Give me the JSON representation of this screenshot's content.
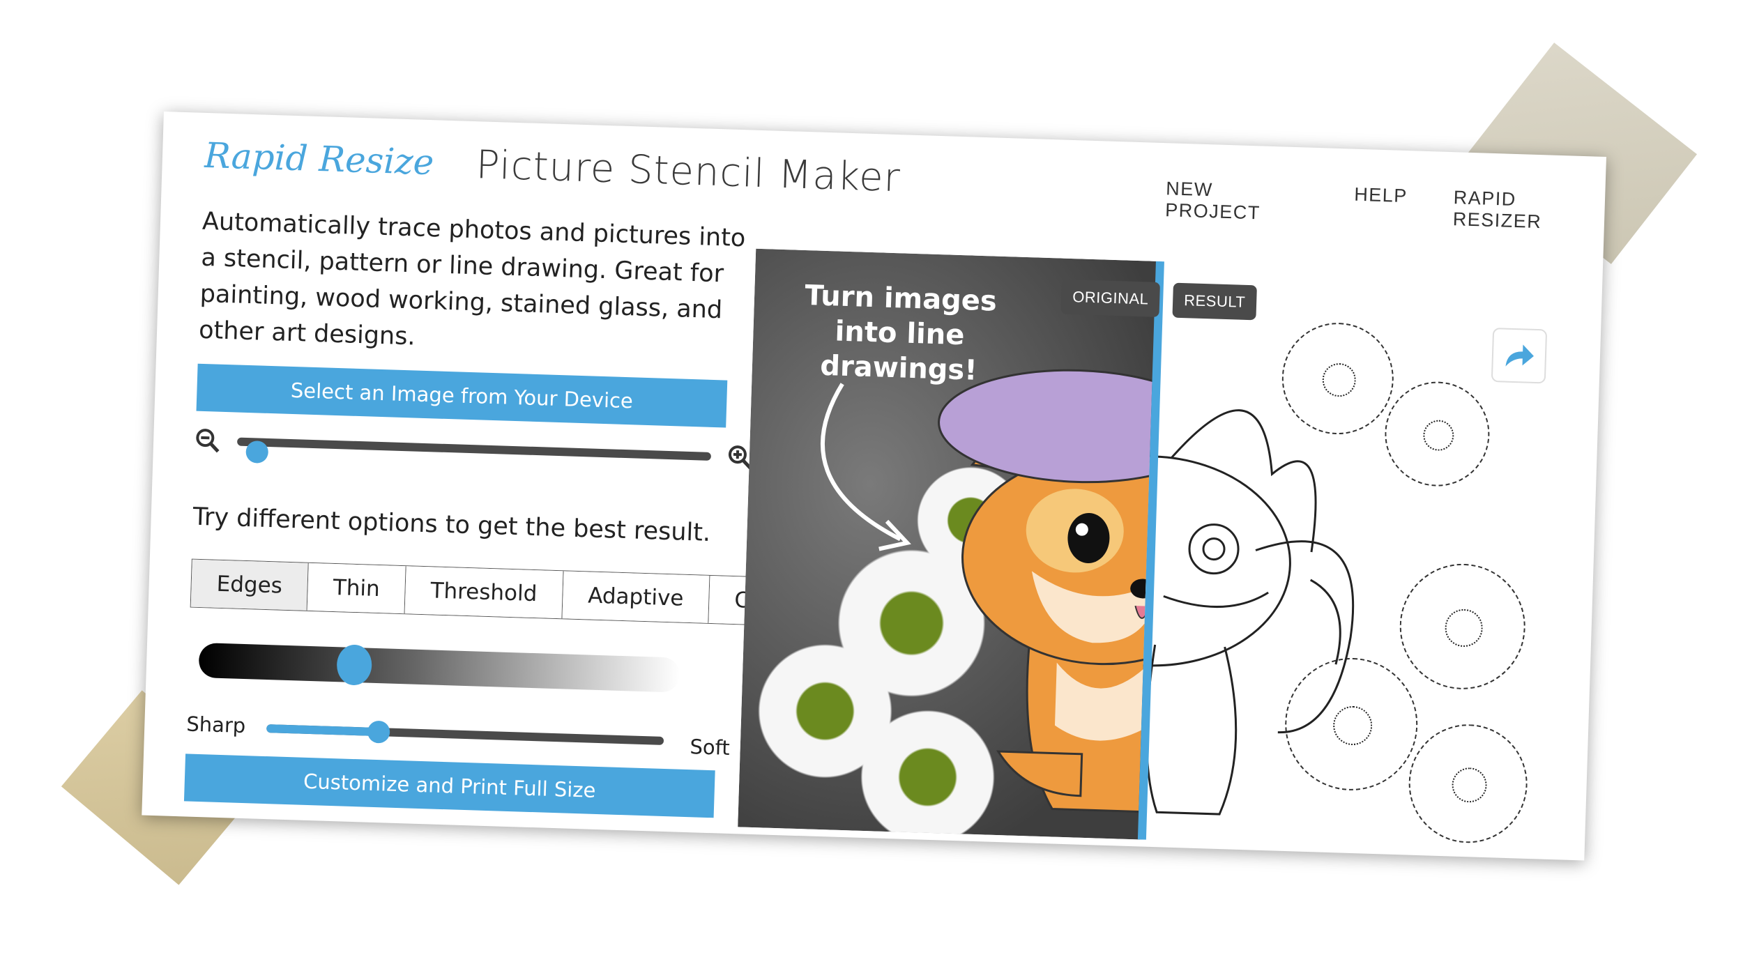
{
  "header": {
    "logo_text": "Rapid Resizer",
    "title": "Picture Stencil Maker"
  },
  "nav": {
    "items": [
      "NEW PROJECT",
      "HELP",
      "RAPID RESIZER"
    ]
  },
  "intro": {
    "text": "Automatically trace photos and pictures into a stencil, pattern or line drawing. Great for painting, wood working, stained glass, and other art designs."
  },
  "actions": {
    "select_label": "Select an Image from Your Device",
    "print_label": "Customize and Print Full Size"
  },
  "zoom": {
    "level": 0.02
  },
  "options": {
    "hint": "Try different options to get the best result.",
    "tabs": [
      {
        "label": "Edges",
        "active": true
      },
      {
        "label": "Thin",
        "active": false
      },
      {
        "label": "Threshold",
        "active": false
      },
      {
        "label": "Adaptive",
        "active": false
      },
      {
        "label": "Color",
        "active": false
      }
    ]
  },
  "threshold": {
    "level": 0.31
  },
  "sharpness": {
    "left_label": "Sharp",
    "right_label": "Soft",
    "level": 0.27
  },
  "preview": {
    "original_badge": "ORIGINAL",
    "result_badge": "RESULT",
    "callout": "Turn images into line drawings!"
  },
  "colors": {
    "accent": "#4aa6dd",
    "text": "#222222",
    "badge_bg": "#4a4a4a"
  },
  "icons": {
    "zoom_out": "zoom-out-icon",
    "zoom_in": "zoom-in-icon",
    "share": "share-arrow-icon",
    "callout_arrow": "curved-arrow-icon"
  }
}
